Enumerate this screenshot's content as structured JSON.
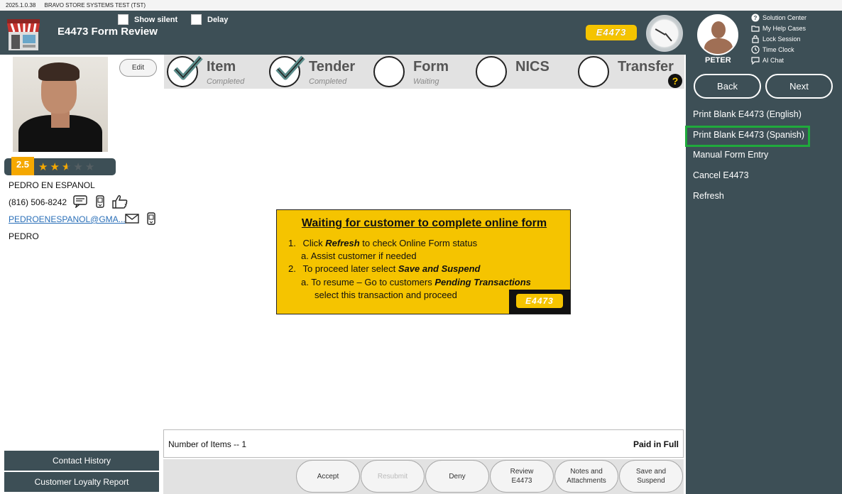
{
  "titlebar": {
    "version": "2025.1.0.38",
    "system": "BRAVO STORE SYSTEMS TEST (TST)"
  },
  "header": {
    "title": "E4473 Form Review",
    "show_silent_label": "Show silent",
    "delay_label": "Delay",
    "badge": "E4473"
  },
  "customer": {
    "edit_label": "Edit",
    "rating": "2.5",
    "name": "PEDRO EN ESPANOL",
    "phone": "(816) 506-8242",
    "email": "PEDROENESPANOL@GMA...",
    "first_name": "PEDRO",
    "contact_history": "Contact History",
    "loyalty_report": "Customer Loyalty Report"
  },
  "steps": [
    {
      "name": "Item",
      "status": "Completed",
      "done": true
    },
    {
      "name": "Tender",
      "status": "Completed",
      "done": true
    },
    {
      "name": "Form",
      "status": "Waiting",
      "done": false
    },
    {
      "name": "NICS",
      "status": "",
      "done": false
    },
    {
      "name": "Transfer",
      "status": "",
      "done": false
    }
  ],
  "notice": {
    "title": "Waiting for customer to complete online form",
    "l1_num": "1.",
    "l1_pre": "Click ",
    "l1_bold": "Refresh",
    "l1_post": " to check Online Form status",
    "l1a": "a.  Assist customer if needed",
    "l2_num": "2.",
    "l2_pre": "To proceed later select ",
    "l2_bold": "Save and Suspend",
    "l2a_pre": "a.  To resume – Go to customers ",
    "l2a_bold": "Pending Transactions",
    "l2a_post": "select this transaction and proceed",
    "badge": "E4473"
  },
  "summary": {
    "items": "Number of Items -- 1",
    "paid": "Paid in Full"
  },
  "actions": {
    "accept": "Accept",
    "resubmit": "Resubmit",
    "deny": "Deny",
    "review_1": "Review",
    "review_2": "E4473",
    "notes_1": "Notes and",
    "notes_2": "Attachments",
    "save_1": "Save and",
    "save_2": "Suspend"
  },
  "user": {
    "name": "PETER"
  },
  "utilities": {
    "solution_center": "Solution Center",
    "help_cases": "My Help Cases",
    "lock_session": "Lock Session",
    "time_clock": "Time Clock",
    "ai_chat": "AI Chat"
  },
  "nav": {
    "back": "Back",
    "next": "Next"
  },
  "menu": {
    "print_english": "Print Blank E4473 (English)",
    "print_spanish": "Print Blank E4473 (Spanish)",
    "manual_entry": "Manual Form Entry",
    "cancel": "Cancel E4473",
    "refresh": "Refresh"
  },
  "colors": {
    "panel": "#3d4f56",
    "accent_yellow": "#f5c400",
    "highlight_green": "#1faa3c",
    "rating_orange": "#f5a800"
  }
}
